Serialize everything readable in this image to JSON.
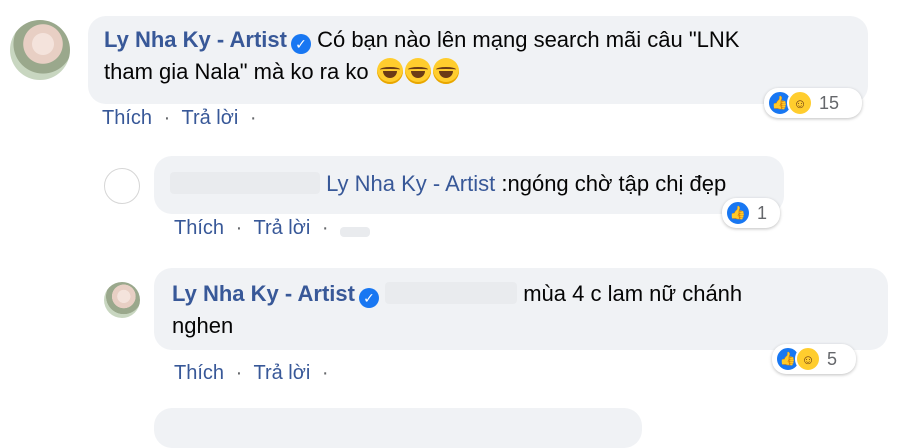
{
  "comments": [
    {
      "author": "Ly Nha Ky - Artist",
      "verified": true,
      "line1": "Có bạn nào lên mạng search mãi câu \"LNK",
      "line2": "tham gia Nala\" mà ko ra ko",
      "emojis": [
        "laugh-cry-emoji",
        "laugh-cry-emoji",
        "laugh-cry-emoji"
      ],
      "actions": {
        "like": "Thích",
        "reply": "Trả lời",
        "sep": "·"
      },
      "reactions": {
        "icons": [
          "like",
          "haha"
        ],
        "count": "15"
      }
    },
    {
      "author_hidden": true,
      "mention": "Ly Nha Ky - Artist",
      "text": ":ngóng chờ tập chị đẹp",
      "actions": {
        "like": "Thích",
        "reply": "Trả lời",
        "sep": "·"
      },
      "reactions": {
        "icons": [
          "like"
        ],
        "count": "1"
      }
    },
    {
      "author": "Ly Nha Ky - Artist",
      "verified": true,
      "line1": "mùa 4 c lam nữ chánh",
      "line2": "nghen",
      "actions": {
        "like": "Thích",
        "reply": "Trả lời",
        "sep": "·"
      },
      "reactions": {
        "icons": [
          "like",
          "haha"
        ],
        "count": "5"
      }
    }
  ],
  "colors": {
    "link": "#385898",
    "bubble": "#f0f2f5",
    "muted": "#65676b",
    "like": "#1877f2",
    "haha": "#ffcd2e"
  }
}
